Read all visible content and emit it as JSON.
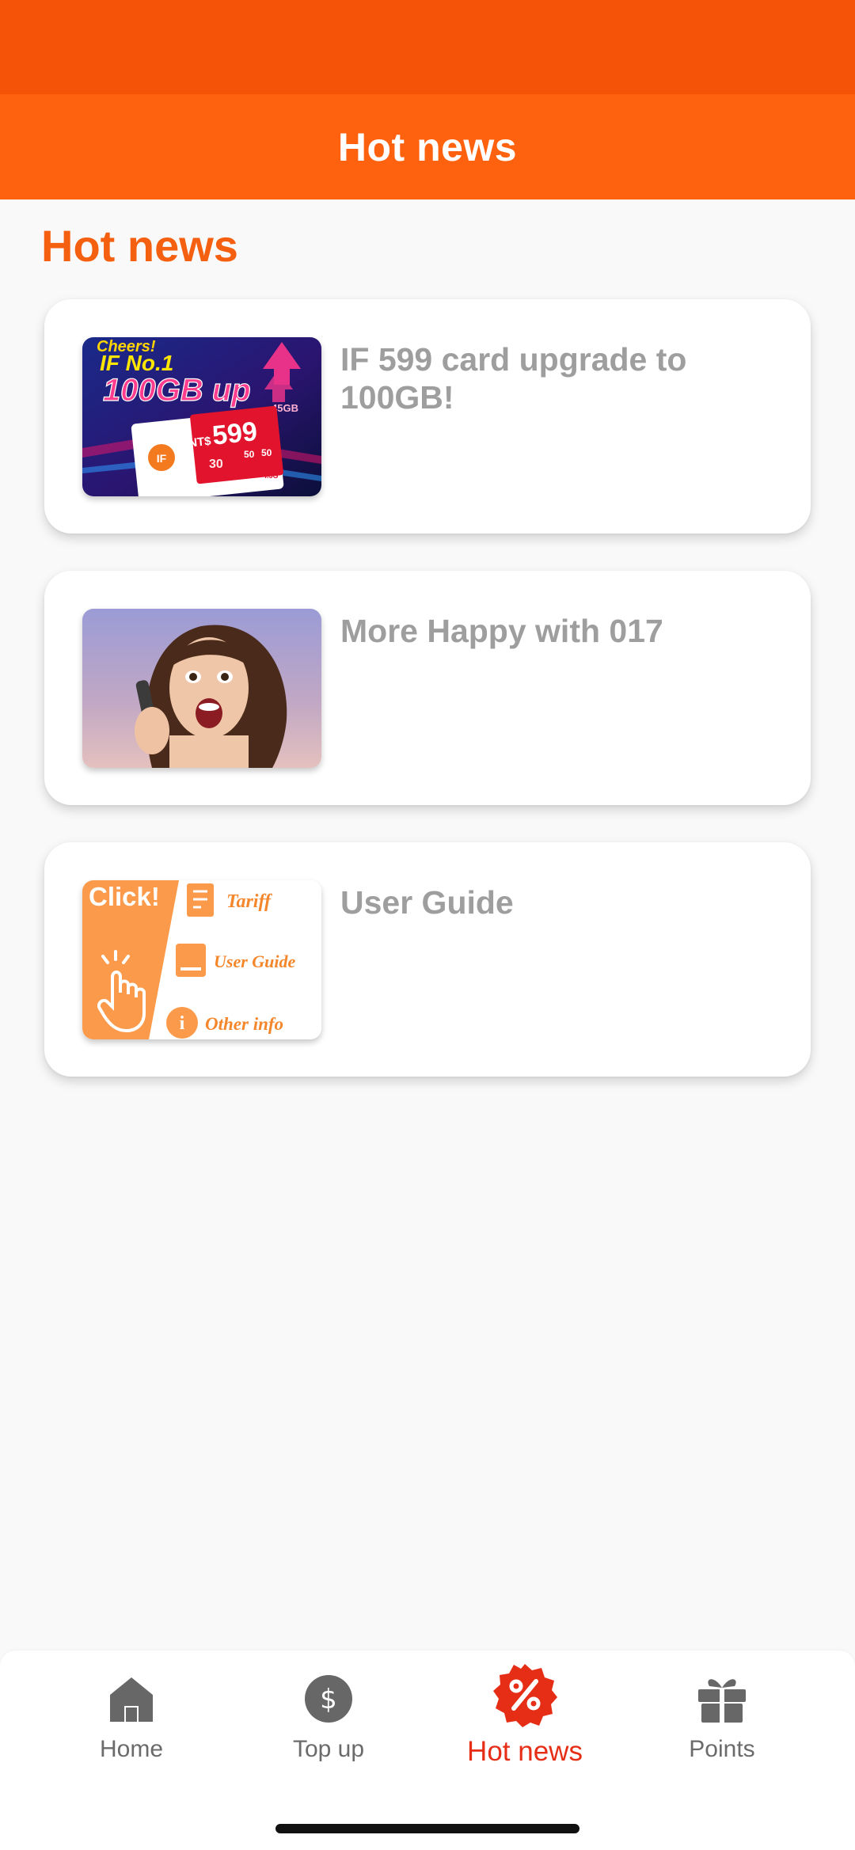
{
  "header": {
    "title": "Hot news"
  },
  "section": {
    "title": "Hot news"
  },
  "news": [
    {
      "title": "IF 599 card upgrade to 100GB!",
      "thumbnail": {
        "banner": "Cheers!",
        "headline": "IF No.1",
        "big_text": "100GB up",
        "gb_badge": "45GB",
        "price_currency": "NT$",
        "price": "599",
        "card_logo": "IF",
        "days": "30",
        "extra_1": "50",
        "extra_2": "50",
        "network": "4.5G"
      }
    },
    {
      "title": "More Happy with 017",
      "thumbnail": {}
    },
    {
      "title": "User Guide",
      "thumbnail": {
        "click": "Click!",
        "item_1": "Tariff",
        "item_2": "User Guide",
        "item_3": "Other info"
      }
    }
  ],
  "nav": {
    "items": [
      {
        "label": "Home",
        "icon": "home-icon"
      },
      {
        "label": "Top up",
        "icon": "dollar-icon"
      },
      {
        "label": "Hot news",
        "icon": "percent-badge-icon",
        "active": true
      },
      {
        "label": "Points",
        "icon": "gift-icon"
      }
    ]
  },
  "colors": {
    "status_bar": "#f55408",
    "header": "#ff620e",
    "accent": "#f4600f",
    "nav_active": "#e62e17",
    "nav_inactive": "#6b6b6b"
  }
}
